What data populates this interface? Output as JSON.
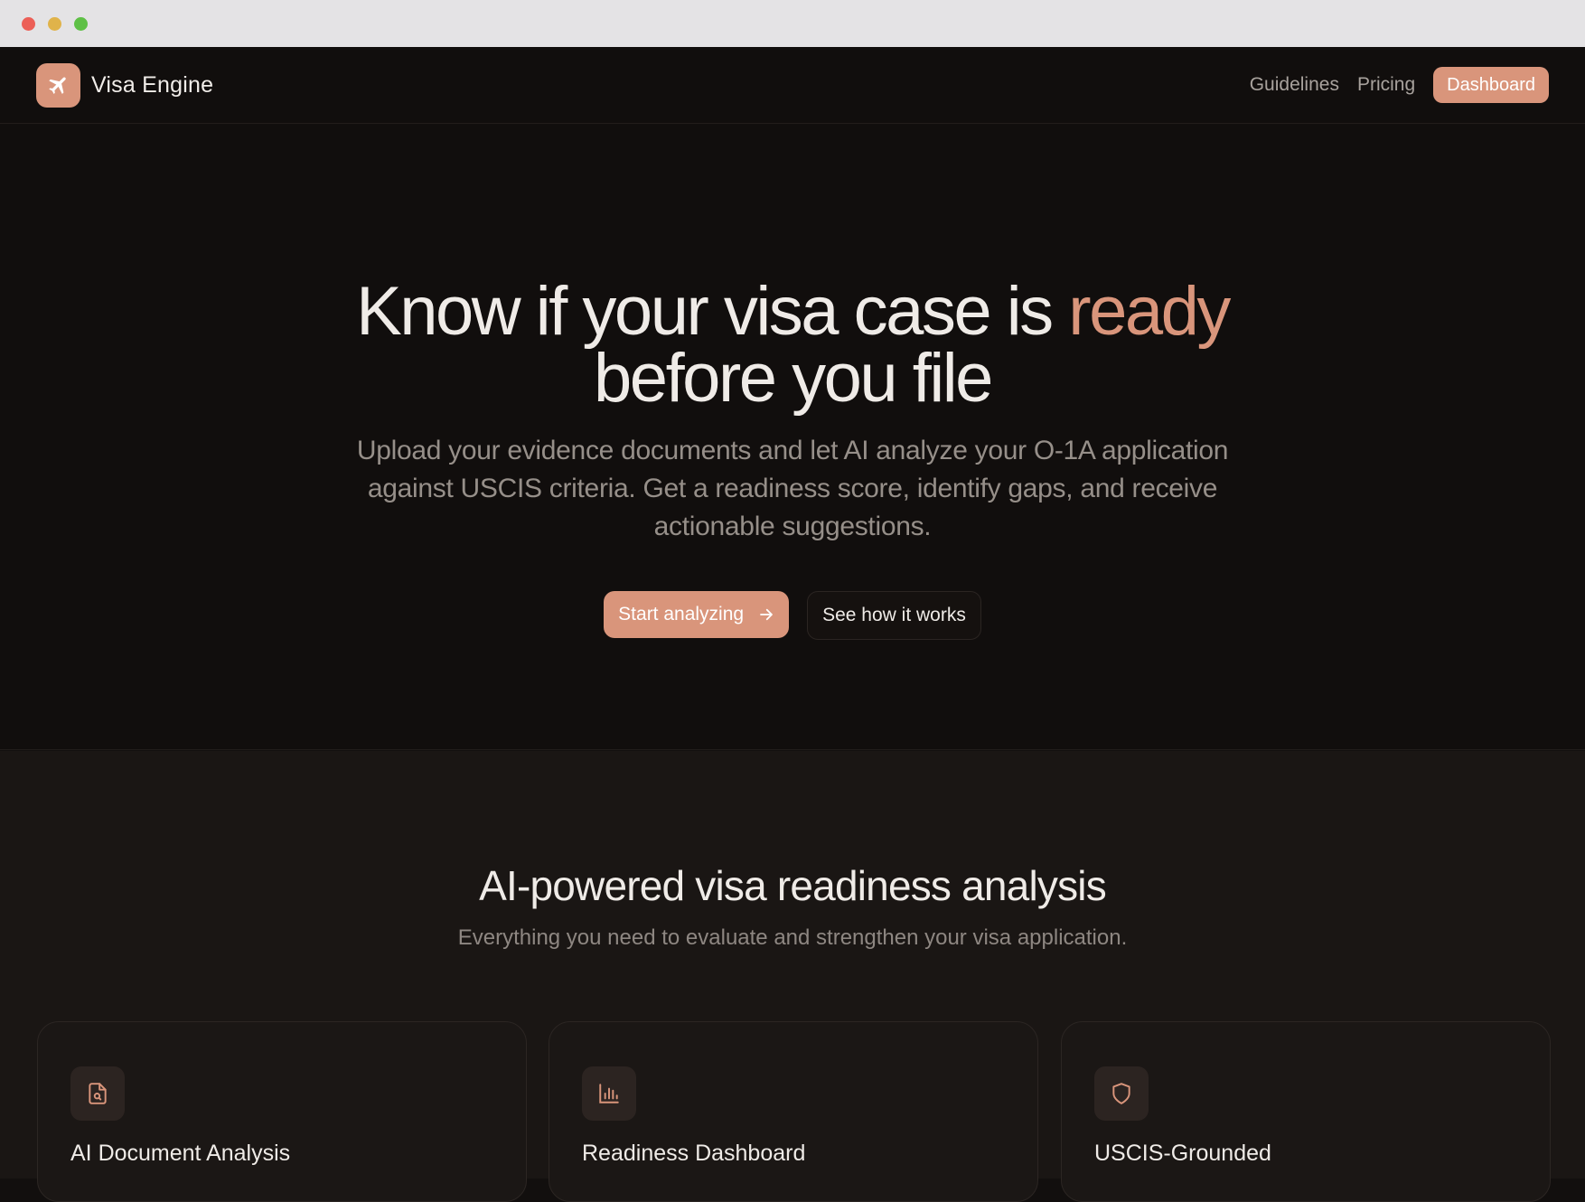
{
  "window": {
    "controls": [
      "close",
      "minimize",
      "maximize"
    ]
  },
  "nav": {
    "brand": "Visa Engine",
    "logo_icon": "plane-icon",
    "links": [
      "Guidelines",
      "Pricing"
    ],
    "dashboard_label": "Dashboard"
  },
  "hero": {
    "title_part1": "Know if your visa case is ",
    "title_accent": "ready",
    "title_part2": "before you file",
    "subtitle": "Upload your evidence documents and let AI analyze your O-1A application against USCIS criteria. Get a readiness score, identify gaps, and receive actionable suggestions.",
    "primary_cta": "Start analyzing",
    "primary_cta_icon": "arrow-right-icon",
    "secondary_cta": "See how it works"
  },
  "features": {
    "heading": "AI-powered visa readiness analysis",
    "subheading": "Everything you need to evaluate and strengthen your visa application.",
    "cards": [
      {
        "title": "AI Document Analysis",
        "icon": "document-search-icon"
      },
      {
        "title": "Readiness Dashboard",
        "icon": "bar-chart-icon"
      },
      {
        "title": "USCIS-Grounded",
        "icon": "shield-icon"
      }
    ]
  },
  "colors": {
    "accent": "#d9957b",
    "background": "#110e0d",
    "section_background": "#1a1614"
  }
}
